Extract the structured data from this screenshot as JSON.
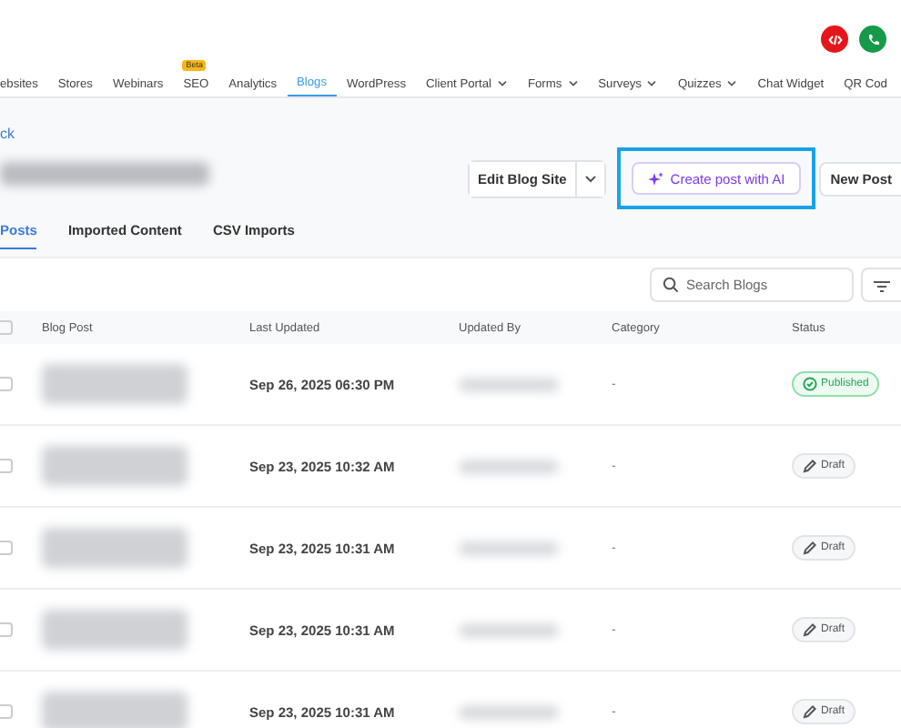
{
  "nav": {
    "items": [
      {
        "label": "ebsites",
        "selected": false,
        "dropdown": false
      },
      {
        "label": "Stores",
        "selected": false,
        "dropdown": false
      },
      {
        "label": "Webinars",
        "selected": false,
        "dropdown": false
      },
      {
        "label": "SEO",
        "selected": false,
        "dropdown": false,
        "badge": "Beta"
      },
      {
        "label": "Analytics",
        "selected": false,
        "dropdown": false
      },
      {
        "label": "Blogs",
        "selected": true,
        "dropdown": false
      },
      {
        "label": "WordPress",
        "selected": false,
        "dropdown": false
      },
      {
        "label": "Client Portal",
        "selected": false,
        "dropdown": true
      },
      {
        "label": "Forms",
        "selected": false,
        "dropdown": true
      },
      {
        "label": "Surveys",
        "selected": false,
        "dropdown": true
      },
      {
        "label": "Quizzes",
        "selected": false,
        "dropdown": true
      },
      {
        "label": "Chat Widget",
        "selected": false,
        "dropdown": false
      },
      {
        "label": "QR Cod",
        "selected": false,
        "dropdown": false
      }
    ]
  },
  "header": {
    "back": "ck",
    "edit_button": "Edit Blog Site",
    "ai_button": "Create post with AI",
    "ai_highlighted": true,
    "new_button": "New Post"
  },
  "tabs": [
    {
      "label": "Posts",
      "selected": true
    },
    {
      "label": "Imported Content",
      "selected": false
    },
    {
      "label": "CSV Imports",
      "selected": false
    }
  ],
  "search": {
    "placeholder": "Search Blogs"
  },
  "table": {
    "all_checked": false,
    "columns": [
      "Blog Post",
      "Last Updated",
      "Updated By",
      "Category",
      "Status"
    ],
    "rows": [
      {
        "checked": false,
        "last_updated": "Sep 26, 2025 06:30 PM",
        "category": "-",
        "status": "Published",
        "kind": "published"
      },
      {
        "checked": false,
        "last_updated": "Sep 23, 2025 10:32 AM",
        "category": "-",
        "status": "Draft",
        "kind": "draft"
      },
      {
        "checked": false,
        "last_updated": "Sep 23, 2025 10:31 AM",
        "category": "-",
        "status": "Draft",
        "kind": "draft"
      },
      {
        "checked": false,
        "last_updated": "Sep 23, 2025 10:31 AM",
        "category": "-",
        "status": "Draft",
        "kind": "draft"
      },
      {
        "checked": false,
        "last_updated": "Sep 23, 2025 10:31 AM",
        "category": "-",
        "status": "Draft",
        "kind": "draft"
      }
    ]
  }
}
